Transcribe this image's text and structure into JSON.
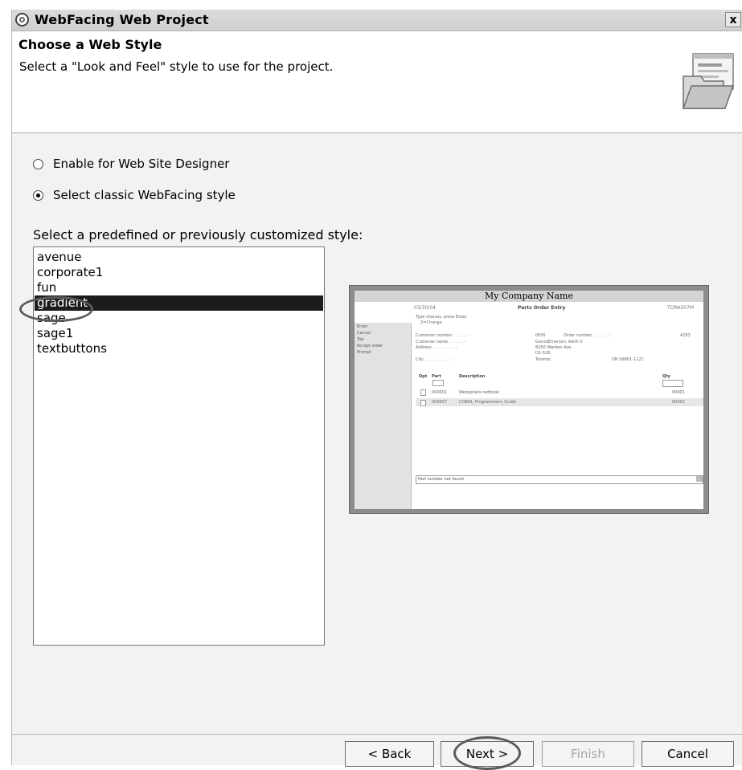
{
  "window": {
    "title": "WebFacing Web Project",
    "close_label": "x"
  },
  "header": {
    "title": "Choose a Web Style",
    "description": "Select a \"Look and Feel\" style to use for the project."
  },
  "options": [
    {
      "label": "Enable for Web Site Designer",
      "selected": false
    },
    {
      "label": "Select classic WebFacing style",
      "selected": true
    }
  ],
  "style_list": {
    "label": "Select a predefined or previously customized style:",
    "items": [
      "avenue",
      "corporate1",
      "fun",
      "gradient",
      "sage",
      "sage1",
      "textbuttons"
    ],
    "selected": "gradient"
  },
  "preview": {
    "company_name": "My Company Name",
    "date": "03/30/04",
    "subtitle": "Parts Order Entry",
    "user": "TORAS07M",
    "instructions": "Type choices, press Enter.",
    "instructions_2": "2=Change",
    "menu": [
      "Enter",
      "Cancel",
      "Top",
      "Accept order",
      "Prompt"
    ],
    "customer_number_label": "Customer number . . . . . . :",
    "customer_number": "0005",
    "order_number_label": "Order number . . . . . . :",
    "order_number": "4283",
    "customer_name_label": "Customer name . . . . . . :",
    "customer_name": "GunzaEmerson, Keith V",
    "address_label": "Address . . . . . . . . . :",
    "address": "8200 Warden Ave.",
    "address_2": "D1-526",
    "city_label": "City . . . . . . . . . . :",
    "city": "Toronto",
    "postal": "ON 99901-1121",
    "columns": [
      "Opt",
      "Part",
      "Description",
      "Qty"
    ],
    "rows": [
      {
        "part": "000001",
        "description": "Websphere redbook",
        "qty": "00001"
      },
      {
        "part": "000057",
        "description": "COBOL_Programmers_Guide",
        "qty": "00002"
      }
    ],
    "message": "Part number not found."
  },
  "buttons": {
    "back": "< Back",
    "next": "Next >",
    "finish": "Finish",
    "cancel": "Cancel"
  }
}
